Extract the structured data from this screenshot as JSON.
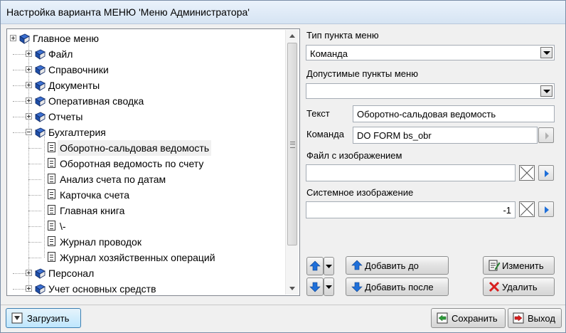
{
  "window": {
    "title": "Настройка варианта МЕНЮ 'Меню Администратора'"
  },
  "tree": {
    "items": [
      {
        "label": "Главное меню",
        "level": 0,
        "kind": "folder",
        "expander": "plus"
      },
      {
        "label": "Файл",
        "level": 1,
        "kind": "folder",
        "expander": "plus"
      },
      {
        "label": "Справочники",
        "level": 1,
        "kind": "folder",
        "expander": "plus"
      },
      {
        "label": "Документы",
        "level": 1,
        "kind": "folder",
        "expander": "plus"
      },
      {
        "label": "Оперативная сводка",
        "level": 1,
        "kind": "folder",
        "expander": "plus"
      },
      {
        "label": "Отчеты",
        "level": 1,
        "kind": "folder",
        "expander": "plus"
      },
      {
        "label": "Бухгалтерия",
        "level": 1,
        "kind": "folder",
        "expander": "minus"
      },
      {
        "label": "Оборотно-сальдовая ведомость",
        "level": 2,
        "kind": "item",
        "selected": true
      },
      {
        "label": "Оборотная ведомость по счету",
        "level": 2,
        "kind": "item"
      },
      {
        "label": "Анализ счета по датам",
        "level": 2,
        "kind": "item"
      },
      {
        "label": "Карточка счета",
        "level": 2,
        "kind": "item"
      },
      {
        "label": "Главная книга",
        "level": 2,
        "kind": "item"
      },
      {
        "label": "\\-",
        "level": 2,
        "kind": "item"
      },
      {
        "label": "Журнал проводок",
        "level": 2,
        "kind": "item"
      },
      {
        "label": "Журнал хозяйственных операций",
        "level": 2,
        "kind": "item"
      },
      {
        "label": "Персонал",
        "level": 1,
        "kind": "folder",
        "expander": "plus"
      },
      {
        "label": "Учет основных средств",
        "level": 1,
        "kind": "folder",
        "expander": "plus"
      }
    ]
  },
  "form": {
    "item_type_label": "Тип пункта меню",
    "item_type_value": "Команда",
    "allowed_items_label": "Допустимые пункты меню",
    "allowed_items_value": "",
    "text_label": "Текст",
    "text_value": "Оборотно-сальдовая ведомость",
    "command_label": "Команда",
    "command_value": "DO FORM bs_obr",
    "image_file_label": "Файл с изображением",
    "image_file_value": "",
    "system_image_label": "Системное изображение",
    "system_image_value": "-1"
  },
  "actions": {
    "add_before": "Добавить до",
    "add_after": "Добавить после",
    "edit": "Изменить",
    "delete": "Удалить"
  },
  "footer": {
    "load": "Загрузить",
    "save": "Сохранить",
    "exit": "Выход"
  },
  "colors": {
    "accent": "#1e6fd9",
    "book": "#1f4fa8",
    "delete": "#d81e1e",
    "save_green": "#2e9b3a"
  }
}
